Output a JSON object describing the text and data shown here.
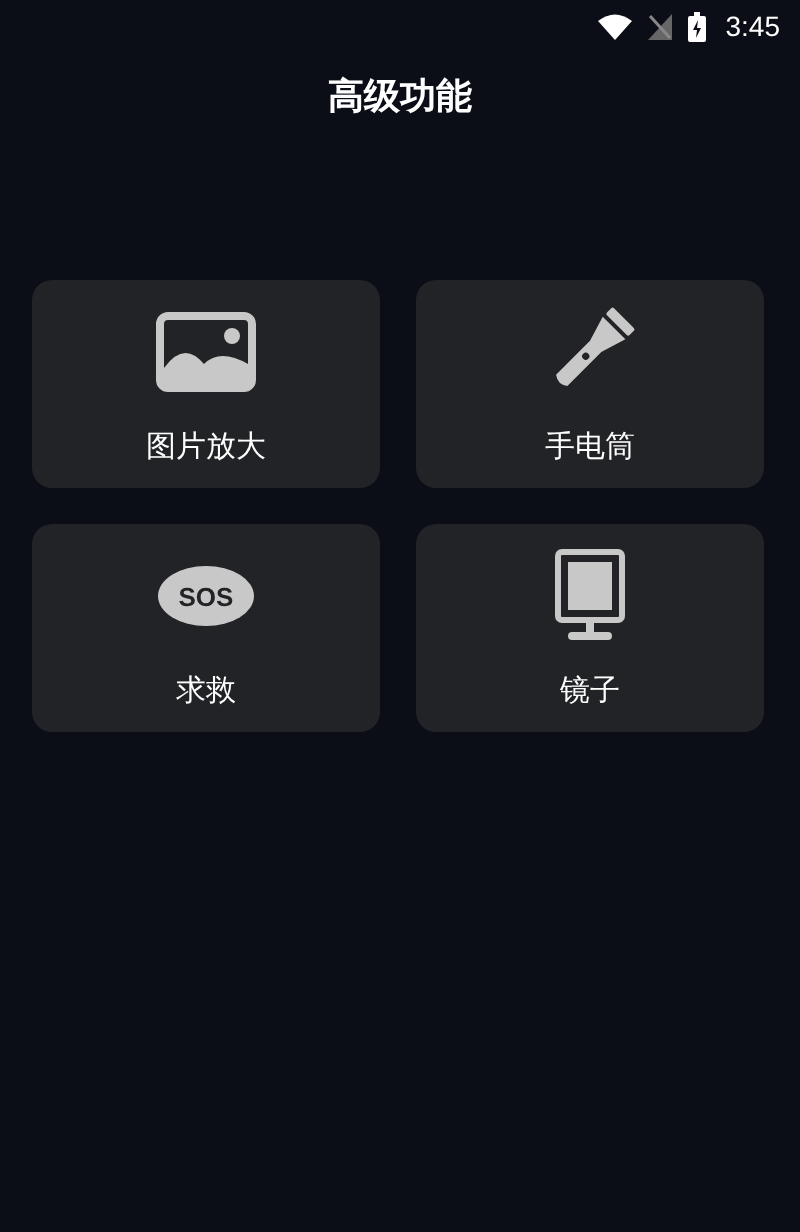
{
  "status_bar": {
    "time": "3:45"
  },
  "title": "高级功能",
  "tiles": [
    {
      "kind": "image",
      "label": "图片放大"
    },
    {
      "kind": "flashlight",
      "label": "手电筒"
    },
    {
      "kind": "sos",
      "icon_text": "SOS",
      "label": "求救"
    },
    {
      "kind": "mirror",
      "label": "镜子"
    }
  ]
}
